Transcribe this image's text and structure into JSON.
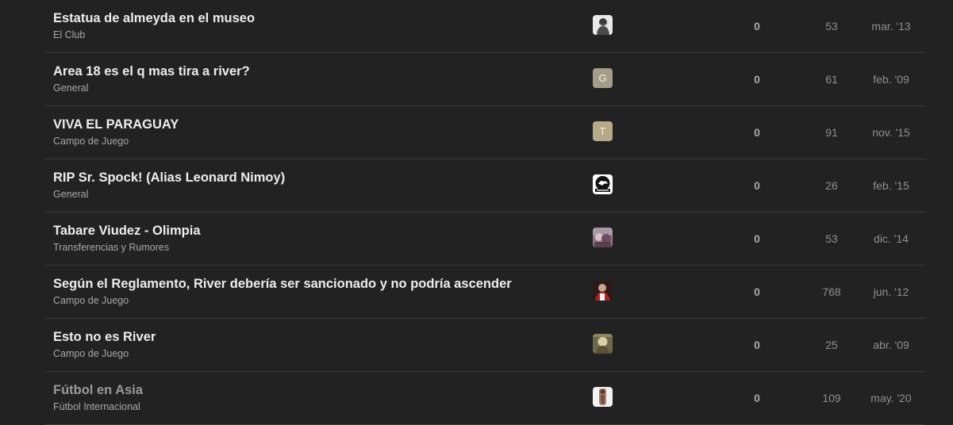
{
  "topics": [
    {
      "title": "Estatua de almeyda en el museo",
      "category": "El Club",
      "avatar": {
        "type": "photo",
        "icon": "user-avatar"
      },
      "replies": "0",
      "views": "53",
      "activity": "mar. '13"
    },
    {
      "title": "Area 18 es el q mas tira a river?",
      "category": "General",
      "avatar": {
        "type": "letter",
        "letter": "G",
        "color": "#a39d8a"
      },
      "replies": "0",
      "views": "61",
      "activity": "feb. '09"
    },
    {
      "title": "VIVA EL PARAGUAY",
      "category": "Campo de Juego",
      "avatar": {
        "type": "letter",
        "letter": "T",
        "color": "#b5a987"
      },
      "replies": "0",
      "views": "91",
      "activity": "nov. '15"
    },
    {
      "title": "RIP Sr. Spock! (Alias Leonard Nimoy)",
      "category": "General",
      "avatar": {
        "type": "logo",
        "icon": "user-avatar"
      },
      "replies": "0",
      "views": "26",
      "activity": "feb. '15"
    },
    {
      "title": "Tabare Viudez - Olimpia",
      "category": "Transferencias y Rumores",
      "avatar": {
        "type": "photo",
        "icon": "user-avatar"
      },
      "replies": "0",
      "views": "53",
      "activity": "dic. '14"
    },
    {
      "title": "Según el Reglamento, River debería ser sancionado y no podría ascender",
      "category": "Campo de Juego",
      "avatar": {
        "type": "photo",
        "icon": "user-avatar"
      },
      "replies": "0",
      "views": "768",
      "activity": "jun. '12"
    },
    {
      "title": "Esto no es River",
      "category": "Campo de Juego",
      "avatar": {
        "type": "photo",
        "icon": "user-avatar"
      },
      "replies": "0",
      "views": "25",
      "activity": "abr. '09"
    },
    {
      "title": "Fútbol en Asia",
      "category": "Fútbol Internacional",
      "avatar": {
        "type": "photo",
        "icon": "user-avatar"
      },
      "replies": "0",
      "views": "109",
      "activity": "may. '20",
      "visited": true
    }
  ],
  "colors": {
    "background": "#222222",
    "title": "#ededed",
    "title_visited": "#9a9a9a",
    "category": "#a8a8a8",
    "divider": "#3a3a3a",
    "replies": "#a9a9a9",
    "meta": "#8f8f8f"
  }
}
